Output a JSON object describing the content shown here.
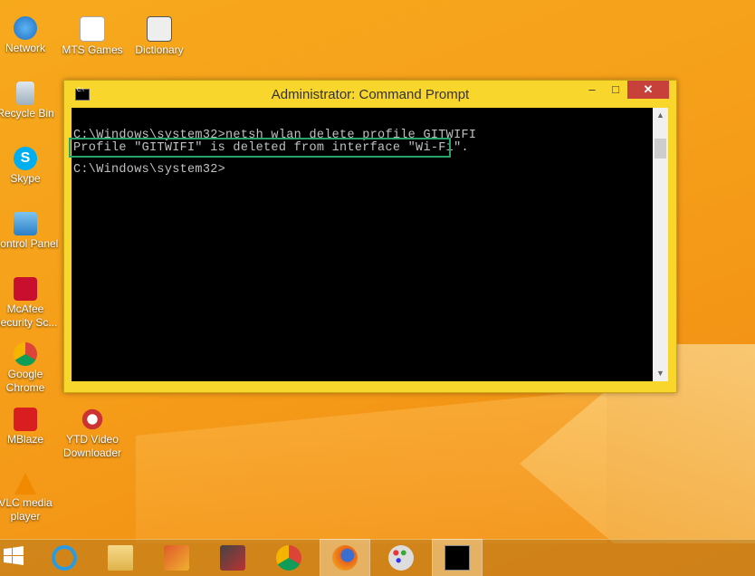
{
  "desktop_icons": [
    {
      "label": "Network"
    },
    {
      "label": "MTS Games"
    },
    {
      "label": "Dictionary"
    },
    {
      "label": "Recycle Bin"
    },
    {
      "label": "Skype"
    },
    {
      "label": "Control Panel"
    },
    {
      "label": "McAfee Security Sc..."
    },
    {
      "label": "Google Chrome"
    },
    {
      "label": "MBlaze"
    },
    {
      "label": "YTD Video Downloader"
    },
    {
      "label": "VLC media player"
    }
  ],
  "window": {
    "title": "Administrator: Command Prompt",
    "console_lines": [
      "C:\\Windows\\system32>netsh wlan delete profile GITWIFI",
      "Profile \"GITWIFI\" is deleted from interface \"Wi-Fi\".",
      "C:\\Windows\\system32>"
    ]
  },
  "taskbar": {
    "items": [
      "start",
      "internet-explorer",
      "file-explorer",
      "media-center",
      "video-editor",
      "chrome",
      "firefox",
      "paint",
      "command-prompt"
    ]
  },
  "colors": {
    "highlight": "#27a36a",
    "window_frame": "#f9d62c",
    "close_button": "#c7413a"
  }
}
